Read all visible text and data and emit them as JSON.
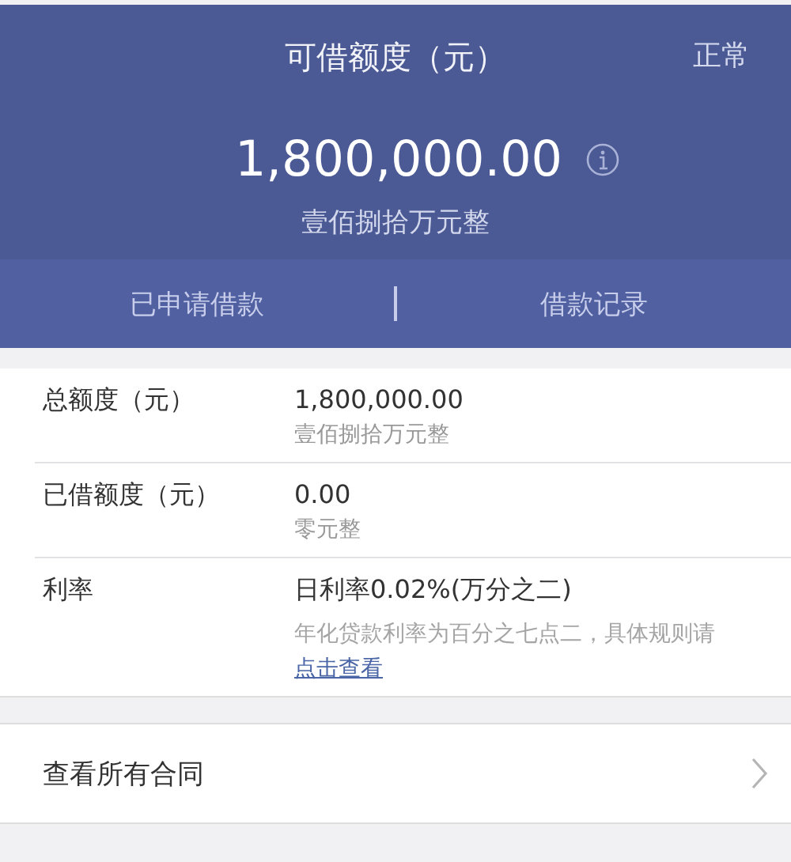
{
  "header": {
    "title": "可借额度（元）",
    "status": "正常",
    "amount": "1,800,000.00",
    "amount_words": "壹佰捌拾万元整"
  },
  "tabs": [
    {
      "label": "已申请借款"
    },
    {
      "label": "借款记录"
    }
  ],
  "details": [
    {
      "label": "总额度（元）",
      "value": "1,800,000.00",
      "sub": "壹佰捌拾万元整"
    },
    {
      "label": "已借额度（元）",
      "value": "0.00",
      "sub": "零元整"
    },
    {
      "label": "利率",
      "value": "日利率0.02%(万分之二)",
      "note": "年化贷款利率为百分之七点二，具体规则请",
      "link": "点击查看"
    }
  ],
  "contracts": {
    "label": "查看所有合同"
  }
}
